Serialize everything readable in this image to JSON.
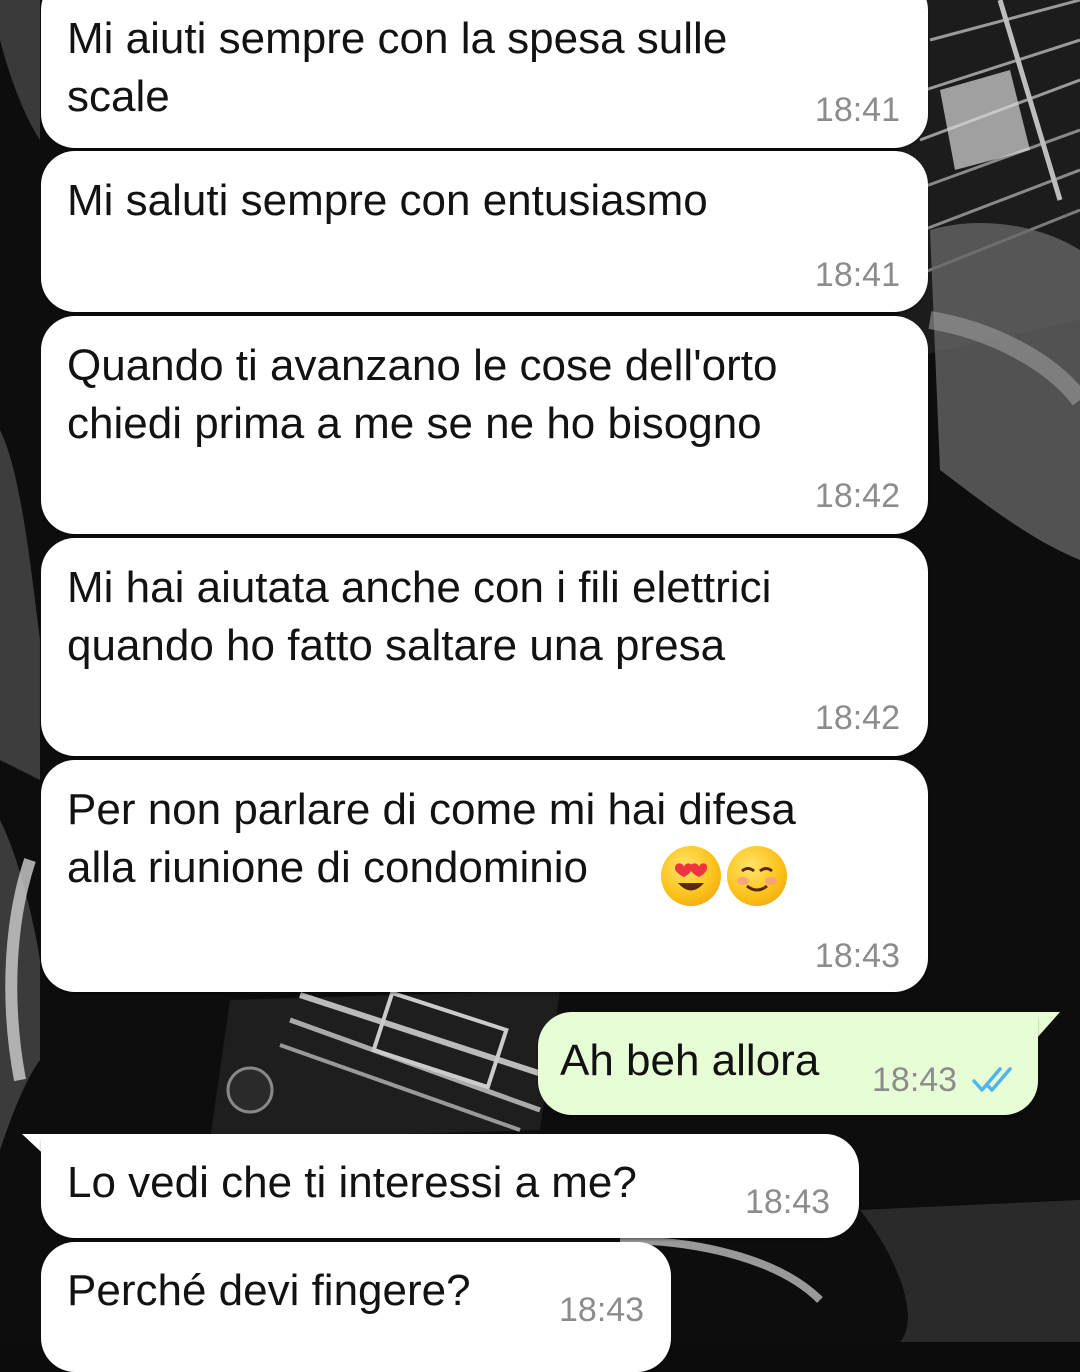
{
  "colors": {
    "incoming_bubble": "#ffffff",
    "outgoing_bubble": "#e7fdd5",
    "text": "#121212",
    "timestamp": "#8c8c8c",
    "read_ticks": "#4fb6ec"
  },
  "messages": [
    {
      "direction": "incoming",
      "text": "Mi aiuti sempre con la spesa sulle\nscale",
      "time": "18:41"
    },
    {
      "direction": "incoming",
      "text": "Mi saluti sempre con entusiasmo",
      "time": "18:41"
    },
    {
      "direction": "incoming",
      "text": "Quando ti avanzano le cose dell'orto\nchiedi prima a me se ne ho bisogno",
      "time": "18:42"
    },
    {
      "direction": "incoming",
      "text": "Mi hai aiutata anche con i fili elettrici\nquando ho fatto saltare una presa",
      "time": "18:42"
    },
    {
      "direction": "incoming",
      "text": "Per non parlare di come mi hai difesa\nalla riunione di condominio",
      "emojis": [
        "smiling-face-with-heart-eyes-icon",
        "smiling-face-icon"
      ],
      "time": "18:43"
    },
    {
      "direction": "outgoing",
      "text": "Ah beh allora",
      "time": "18:43",
      "status_icon": "double-check-read-icon"
    },
    {
      "direction": "incoming",
      "text": "Lo vedi che ti interessi a me?",
      "time": "18:43"
    },
    {
      "direction": "incoming",
      "text": "Perché devi fingere?",
      "time": "18:43"
    }
  ]
}
